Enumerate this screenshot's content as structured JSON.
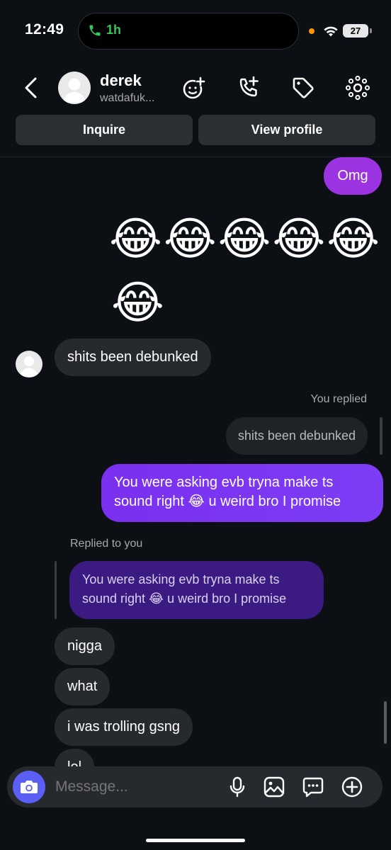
{
  "status_bar": {
    "time": "12:49",
    "call_duration": "1h",
    "battery": "27"
  },
  "header": {
    "name": "derek",
    "handle": "watdafuk..."
  },
  "actions": {
    "inquire": "Inquire",
    "view_profile": "View profile"
  },
  "messages": {
    "omg": "Omg",
    "emoji_row": "😂😂😂😂😂",
    "emoji_single": "😂",
    "debunked": "shits been debunked",
    "you_replied": "You replied",
    "quoted_debunked": "shits been debunked",
    "asking_line1": "You were asking evb tryna make ts",
    "asking_line2": "sound right 😂 u weird bro I promise",
    "replied_to_you": "Replied to you",
    "quoted_asking_line1": "You were asking evb tryna make ts",
    "quoted_asking_line2": "sound right 😂 u weird bro I promise",
    "nigga": "nigga",
    "what": "what",
    "trolling": "i was trolling gsng",
    "lol": "lol"
  },
  "composer": {
    "placeholder": "Message..."
  },
  "icons": {
    "back": "chevron-left-icon",
    "avatar_effects": "face-plus-icon",
    "call": "phone-plus-icon",
    "tag": "tag-icon",
    "more": "dots-grid-icon",
    "camera": "camera-icon",
    "mic": "microphone-icon",
    "gallery": "gallery-icon",
    "sticker": "chat-bubble-icon",
    "add": "plus-circle-icon"
  },
  "colors": {
    "background": "#0c1014",
    "outgoing": "#7b2ff0",
    "incoming": "#262a2e",
    "camera_button": "#5b5ff3"
  }
}
